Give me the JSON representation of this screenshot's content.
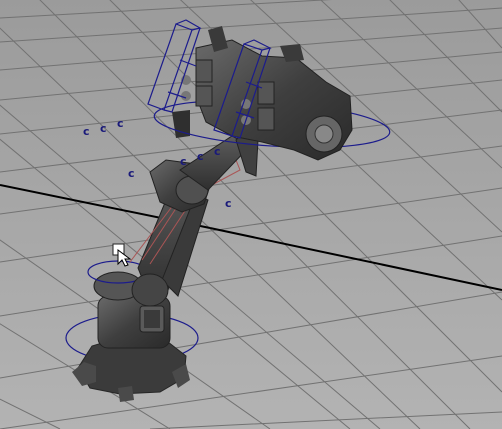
{
  "viewport": {
    "name": "perspective-3d-viewport",
    "background_color": "#a8a8a8",
    "grid_color": "#6e6e6e",
    "axis_color": "#000000",
    "selection_color": "#1c1c8c",
    "model_color": "#4a4a4a"
  },
  "locator_glyph": "c",
  "locators": [
    "c",
    "c",
    "c",
    "c",
    "c",
    "c",
    "c",
    "c"
  ],
  "cursor": "select-cursor-icon"
}
